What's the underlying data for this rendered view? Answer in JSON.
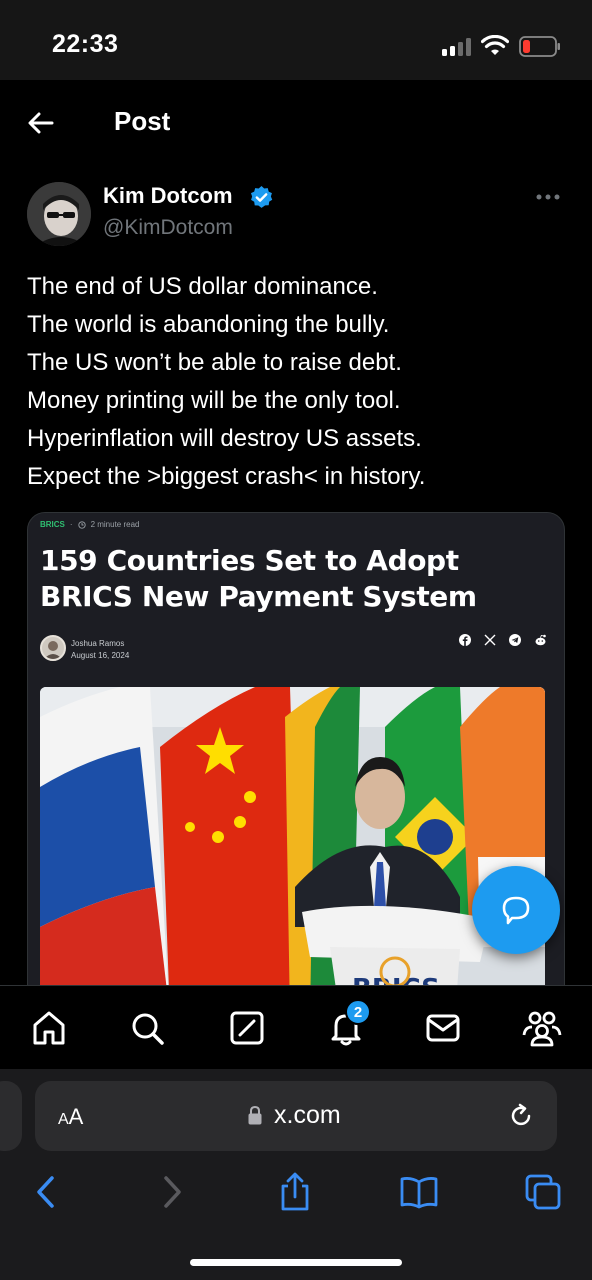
{
  "status_bar": {
    "time": "22:33"
  },
  "header": {
    "title": "Post"
  },
  "author": {
    "display_name": "Kim Dotcom",
    "handle": "@KimDotcom"
  },
  "tweet": {
    "lines": [
      "The end of US dollar dominance.",
      "The world is abandoning the bully.",
      "The US won’t be able to raise debt.",
      "Money printing will be the only tool.",
      "Hyperinflation will destroy US assets.",
      "Expect the >biggest crash< in history."
    ]
  },
  "card": {
    "tag": "BRICS",
    "read_time": "2 minute read",
    "headline": "159 Countries Set to Adopt BRICS New Payment System",
    "author_name": "Joshua Ramos",
    "date": "August 16, 2024",
    "photo_sign": "BRICS"
  },
  "nav": {
    "notification_count": "2"
  },
  "browser": {
    "aa_big": "A",
    "aa_small": "A",
    "url": "x.com"
  },
  "colors": {
    "accent": "#1d9bf0",
    "background": "#000000",
    "muted": "#71767b"
  }
}
